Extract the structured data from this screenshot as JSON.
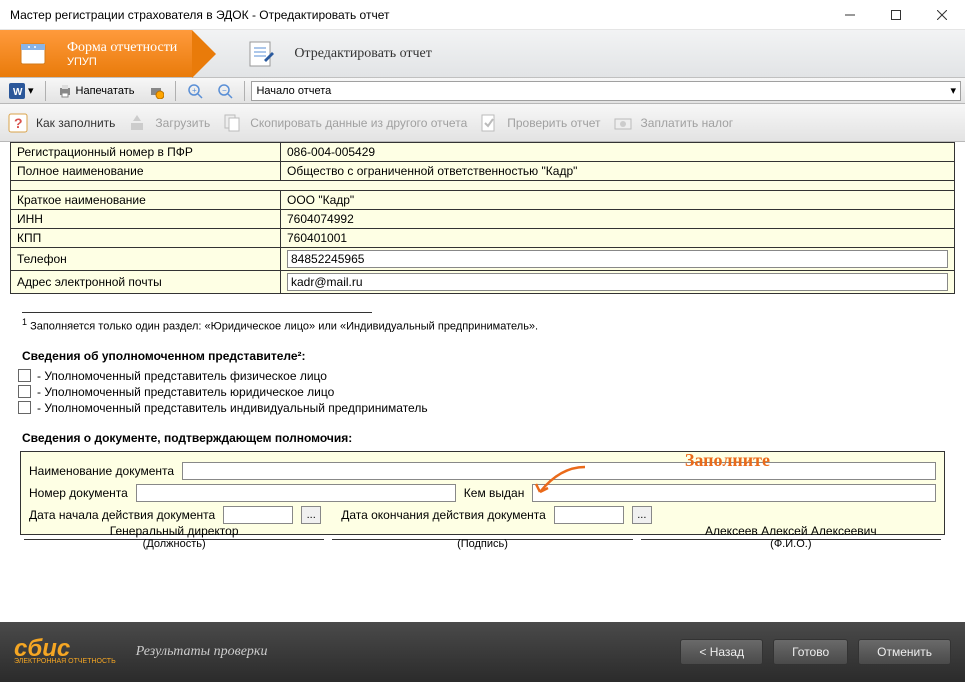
{
  "window": {
    "title": "Мастер регистрации страхователя в ЭДОК - Отредактировать отчет"
  },
  "wizard": {
    "step1_title": "Форма отчетности",
    "step1_sub": "УПУП",
    "step2_title": "Отредактировать отчет"
  },
  "toolbar1": {
    "print": "Напечатать",
    "section": "Начало отчета"
  },
  "toolbar2": {
    "howto": "Как заполнить",
    "load": "Загрузить",
    "copy": "Скопировать данные из другого отчета",
    "check": "Проверить отчет",
    "pay": "Заплатить налог"
  },
  "table": {
    "reg_label": "Регистрационный номер в ПФР",
    "reg_val": "086-004-005429",
    "full_label": "Полное наименование",
    "full_val": "Общество с ограниченной ответственностью \"Кадр\"",
    "short_label": "Краткое наименование",
    "short_val": "ООО \"Кадр\"",
    "inn_label": "ИНН",
    "inn_val": "7604074992",
    "kpp_label": "КПП",
    "kpp_val": "760401001",
    "phone_label": "Телефон",
    "phone_val": "84852245965",
    "email_label": "Адрес электронной почты",
    "email_val": "kadr@mail.ru"
  },
  "footnote": {
    "text": "Заполняется только один раздел: «Юридическое лицо» или «Индивидуальный предприниматель»."
  },
  "rep": {
    "title": "Сведения об уполномоченном представителе²:",
    "opt1": "- Уполномоченный представитель физическое лицо",
    "opt2": "- Уполномоченный представитель юридическое лицо",
    "opt3": "- Уполномоченный представитель индивидуальный предприниматель"
  },
  "doc": {
    "title": "Сведения о документе, подтверждающем полномочия:",
    "name_label": "Наименование документа",
    "num_label": "Номер документа",
    "issued_label": "Кем выдан",
    "start_label": "Дата начала действия документа",
    "end_label": "Дата окончания действия документа"
  },
  "annotation": "Заполните",
  "sign": {
    "pos": "Генеральный директор",
    "pos_sub": "(Должность)",
    "sig_sub": "(Подпись)",
    "fio": "Алексеев Алексей Алексеевич",
    "fio_sub": "(Ф.И.О.)"
  },
  "footer": {
    "logo": "сбис",
    "logo_sub": "ЭЛЕКТРОННАЯ ОТЧЕТНОСТЬ",
    "status": "Результаты проверки",
    "back": "< Назад",
    "ready": "Готово",
    "cancel": "Отменить"
  }
}
